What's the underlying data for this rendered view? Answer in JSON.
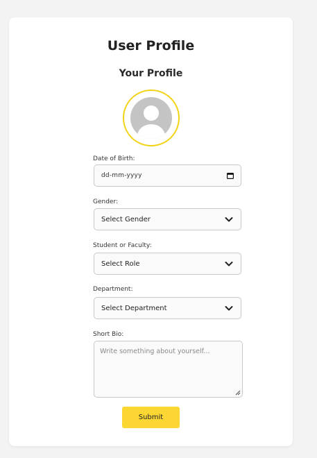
{
  "page": {
    "title": "User Profile",
    "section_title": "Your Profile"
  },
  "avatar": {
    "icon": "user-avatar-icon",
    "ring_color": "#f2d316"
  },
  "form": {
    "dob": {
      "label": "Date of Birth:",
      "placeholder": "dd-mm-yyyy",
      "icon": "calendar-icon"
    },
    "gender": {
      "label": "Gender:",
      "selected": "Select Gender",
      "icon": "chevron-down-icon"
    },
    "role": {
      "label": "Student or Faculty:",
      "selected": "Select Role",
      "icon": "chevron-down-icon"
    },
    "department": {
      "label": "Department:",
      "selected": "Select Department",
      "icon": "chevron-down-icon"
    },
    "bio": {
      "label": "Short Bio:",
      "placeholder": "Write something about yourself..."
    },
    "submit_label": "Submit"
  },
  "colors": {
    "accent": "#fcd734",
    "background": "#f3f3f3",
    "card": "#ffffff"
  }
}
